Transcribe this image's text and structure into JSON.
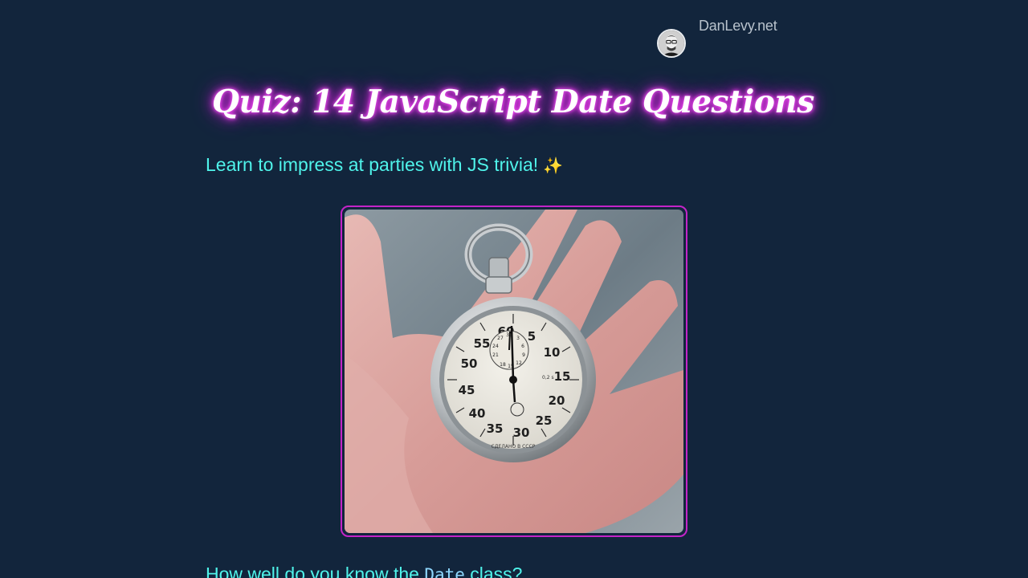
{
  "header": {
    "site_name": "DanLevy.net",
    "avatar_icon": "person-avatar-icon"
  },
  "article": {
    "title": "Quiz: 14 JavaScript Date Questions",
    "subtitle": "Learn to impress at parties with JS trivia!",
    "subtitle_emoji": "✨",
    "intro_before": "How well do you know the ",
    "intro_code": "Date",
    "intro_after": " class?"
  },
  "hero": {
    "icon": "stopwatch-icon",
    "dial_numbers": [
      "60",
      "5",
      "10",
      "15",
      "20",
      "25",
      "30",
      "35",
      "40",
      "45",
      "50",
      "55"
    ],
    "subdial_numbers": [
      "30",
      "3",
      "27",
      "6",
      "24",
      "9",
      "21",
      "12",
      "18",
      "15"
    ],
    "dial_small_text": "0,2 s",
    "dial_brand": "СДЕЛАНО В СССР"
  },
  "colors": {
    "background": "#12253c",
    "accent_cyan": "#4ff3ea",
    "accent_magenta": "#c424c8",
    "title_glow": "#e63ee6"
  }
}
